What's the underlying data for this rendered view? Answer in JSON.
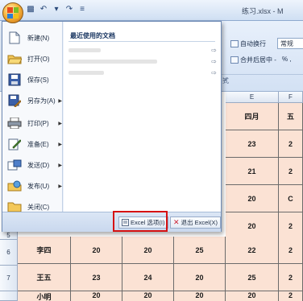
{
  "window": {
    "title": "练习.xlsx - M"
  },
  "office_menu": {
    "items": [
      {
        "label": "新建(N)",
        "icon": "new-document-icon",
        "has_arrow": false
      },
      {
        "label": "打开(O)",
        "icon": "open-folder-icon",
        "has_arrow": false
      },
      {
        "label": "保存(S)",
        "icon": "save-disk-icon",
        "has_arrow": false
      },
      {
        "label": "另存为(A)",
        "icon": "save-as-icon",
        "has_arrow": true
      },
      {
        "label": "打印(P)",
        "icon": "printer-icon",
        "has_arrow": true
      },
      {
        "label": "准备(E)",
        "icon": "prepare-icon",
        "has_arrow": true
      },
      {
        "label": "发送(D)",
        "icon": "send-icon",
        "has_arrow": true
      },
      {
        "label": "发布(U)",
        "icon": "publish-icon",
        "has_arrow": true
      },
      {
        "label": "关闭(C)",
        "icon": "close-folder-icon",
        "has_arrow": false
      }
    ],
    "recent_title": "最近使用的文档",
    "recent_count_visible": 4,
    "options_button": "Excel 选项(I)",
    "exit_button": "退出 Excel(X)"
  },
  "ribbon": {
    "wrap_text": "自动换行",
    "merge_center": "合并后居中 -",
    "number_format": "常规",
    "percent": "% ,",
    "group_label": "式"
  },
  "sheet": {
    "col_e": "E",
    "col_f": "F",
    "header_row": [
      "四月",
      "五"
    ],
    "right_values": [
      [
        "23",
        "2"
      ],
      [
        "21",
        "2"
      ],
      [
        "20",
        "C"
      ],
      [
        "20",
        "2"
      ]
    ],
    "row_numbers": [
      "5",
      "6",
      "7"
    ],
    "rows": [
      [
        "李四",
        "20",
        "20",
        "25",
        "22",
        "2"
      ],
      [
        "王五",
        "23",
        "24",
        "20",
        "25",
        "2"
      ],
      [
        "小明",
        "20",
        "20",
        "20",
        "20",
        "2"
      ]
    ]
  }
}
